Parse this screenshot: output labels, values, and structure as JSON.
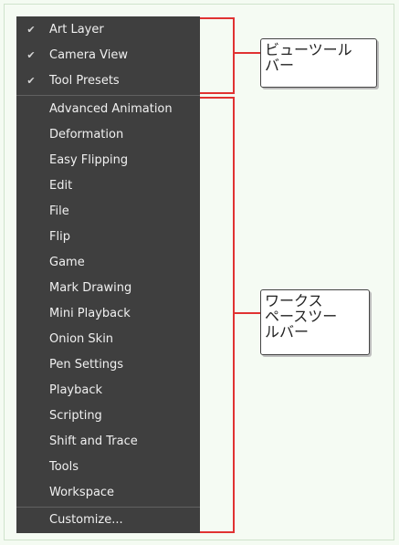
{
  "view_toolbars": [
    {
      "label": "Art Layer",
      "checked": true
    },
    {
      "label": "Camera View",
      "checked": true
    },
    {
      "label": "Tool Presets",
      "checked": true
    }
  ],
  "workspace_toolbars": [
    {
      "label": "Advanced Animation"
    },
    {
      "label": "Deformation"
    },
    {
      "label": "Easy Flipping"
    },
    {
      "label": "Edit"
    },
    {
      "label": "File"
    },
    {
      "label": "Flip"
    },
    {
      "label": "Game"
    },
    {
      "label": "Mark Drawing"
    },
    {
      "label": "Mini Playback"
    },
    {
      "label": "Onion Skin"
    },
    {
      "label": "Pen Settings"
    },
    {
      "label": "Playback"
    },
    {
      "label": "Scripting"
    },
    {
      "label": "Shift and Trace"
    },
    {
      "label": "Tools"
    },
    {
      "label": "Workspace"
    }
  ],
  "customize_label": "Customize...",
  "check_glyph": "✔",
  "callouts": {
    "view": "ビューツール\nバー",
    "workspace": "ワークス\nペースツー\nルバー"
  },
  "colors": {
    "menu_bg": "#3f3f3f",
    "bracket": "#e03232",
    "page_bg": "#f4fbf2"
  }
}
